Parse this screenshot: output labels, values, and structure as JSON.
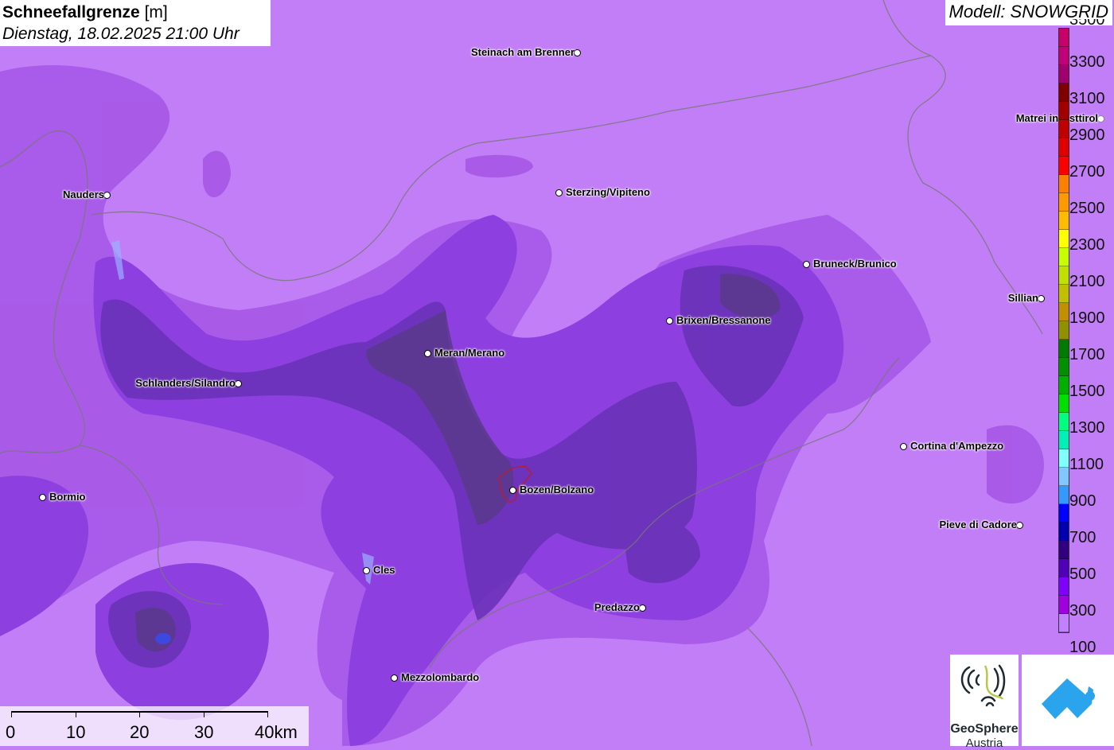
{
  "title": {
    "main": "Schneefallgrenze",
    "unit": "[m]",
    "datetime": "Dienstag, 18.02.2025 21:00 Uhr"
  },
  "model": "Modell: SNOWGRID",
  "legend": {
    "labels": [
      "3500",
      "3300",
      "3100",
      "2900",
      "2700",
      "2500",
      "2300",
      "2100",
      "1900",
      "1700",
      "1500",
      "1300",
      "1100",
      "900",
      "700",
      "500",
      "300",
      "100"
    ],
    "colors": [
      "#c8006a",
      "#c00078",
      "#a0006e",
      "#800000",
      "#a00000",
      "#c00000",
      "#e00000",
      "#ff0000",
      "#ff7f00",
      "#ff9900",
      "#ffbb00",
      "#ffff00",
      "#c8ff00",
      "#bfe000",
      "#c0c000",
      "#c09000",
      "#909000",
      "#007a00",
      "#009000",
      "#00b000",
      "#00e000",
      "#00ff80",
      "#00f0b8",
      "#80ffff",
      "#80c8ff",
      "#3399ff",
      "#0000ff",
      "#0000b0",
      "#300080",
      "#5000b8",
      "#8000ff",
      "#a000e0",
      "#c080ff"
    ]
  },
  "cities": [
    {
      "name": "Steinach am Brenner",
      "side": "left"
    },
    {
      "name": "Matrei in Osttirol",
      "side": "left"
    },
    {
      "name": "Nauders",
      "side": "left"
    },
    {
      "name": "Sterzing/Vipiteno",
      "side": "right"
    },
    {
      "name": "Bruneck/Brunico",
      "side": "right"
    },
    {
      "name": "Sillian",
      "side": "left"
    },
    {
      "name": "Brixen/Bressanone",
      "side": "right"
    },
    {
      "name": "Meran/Merano",
      "side": "right"
    },
    {
      "name": "Schlanders/Silandro",
      "side": "left"
    },
    {
      "name": "Cortina d'Ampezzo",
      "side": "right"
    },
    {
      "name": "Bormio",
      "side": "right"
    },
    {
      "name": "Bozen/Bolzano",
      "side": "right"
    },
    {
      "name": "Pieve di Cadore",
      "side": "left"
    },
    {
      "name": "Cles",
      "side": "right"
    },
    {
      "name": "Predazzo",
      "side": "left"
    },
    {
      "name": "Mezzolombardo",
      "side": "right"
    }
  ],
  "scale": {
    "labels": [
      "0",
      "10",
      "20",
      "30",
      "40km"
    ]
  },
  "logos": {
    "geosphere_line1": "GeoSphere",
    "geosphere_line2": "Austria"
  }
}
